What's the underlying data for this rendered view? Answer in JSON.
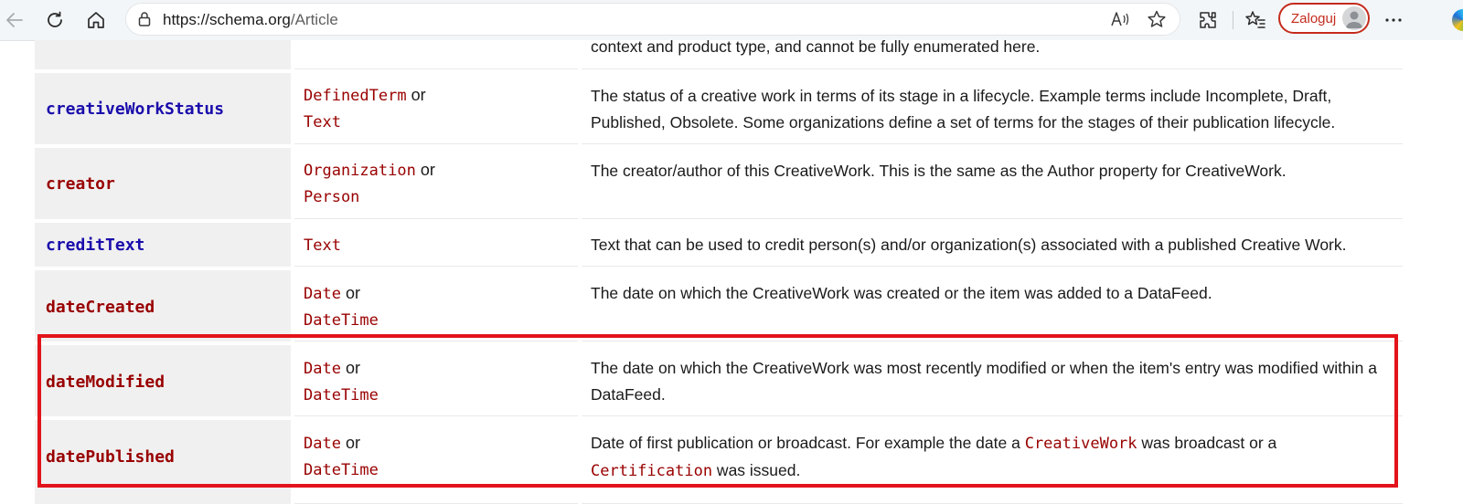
{
  "browser": {
    "url_host": "https://schema.org",
    "url_path": "/Article",
    "profile_label": "Zaloguj",
    "icons": [
      "back-arrow-icon",
      "refresh-icon",
      "home-icon",
      "lock-icon",
      "read-aloud-icon",
      "favorite-star-icon",
      "extensions-icon",
      "favorites-icon",
      "avatar-icon",
      "more-icon",
      "edge-copilot-icon"
    ]
  },
  "table": {
    "partial_row": {
      "description": "context and product type, and cannot be fully enumerated here."
    },
    "rows": [
      {
        "property": "creativeWorkStatus",
        "property_color": "blue",
        "types": [
          {
            "name": "DefinedTerm",
            "suffix": " or"
          },
          {
            "name": "Text",
            "suffix": ""
          }
        ],
        "description": "The status of a creative work in terms of its stage in a lifecycle. Example terms include Incomplete, Draft, Published, Obsolete. Some organizations define a set of terms for the stages of their publication lifecycle."
      },
      {
        "property": "creator",
        "property_color": "red",
        "types": [
          {
            "name": "Organization",
            "suffix": " or"
          },
          {
            "name": "Person",
            "suffix": ""
          }
        ],
        "description": "The creator/author of this CreativeWork. This is the same as the Author property for CreativeWork."
      },
      {
        "property": "creditText",
        "property_color": "blue",
        "types": [
          {
            "name": "Text",
            "suffix": ""
          }
        ],
        "description": "Text that can be used to credit person(s) and/or organization(s) associated with a published Creative Work."
      },
      {
        "property": "dateCreated",
        "property_color": "red",
        "types": [
          {
            "name": "Date",
            "suffix": " or"
          },
          {
            "name": "DateTime",
            "suffix": ""
          }
        ],
        "description": "The date on which the CreativeWork was created or the item was added to a DataFeed."
      },
      {
        "property": "dateModified",
        "property_color": "red",
        "types": [
          {
            "name": "Date",
            "suffix": " or"
          },
          {
            "name": "DateTime",
            "suffix": ""
          }
        ],
        "description": "The date on which the CreativeWork was most recently modified or when the item's entry was modified within a DataFeed."
      },
      {
        "property": "datePublished",
        "property_color": "red",
        "types": [
          {
            "name": "Date",
            "suffix": " or"
          },
          {
            "name": "DateTime",
            "suffix": ""
          }
        ],
        "description_parts": [
          {
            "text": "Date of first publication or broadcast. For example the date a ",
            "code": false
          },
          {
            "text": "CreativeWork",
            "code": true
          },
          {
            "text": " was broadcast or a ",
            "code": false
          },
          {
            "text": "Certification",
            "code": true
          },
          {
            "text": " was issued.",
            "code": false
          }
        ]
      }
    ]
  },
  "colors": {
    "property_blue": "#1a0dab",
    "property_red": "#990000",
    "type_code": "#990000",
    "highlight": "#e3131b",
    "profile_accent": "#c42b1c"
  }
}
